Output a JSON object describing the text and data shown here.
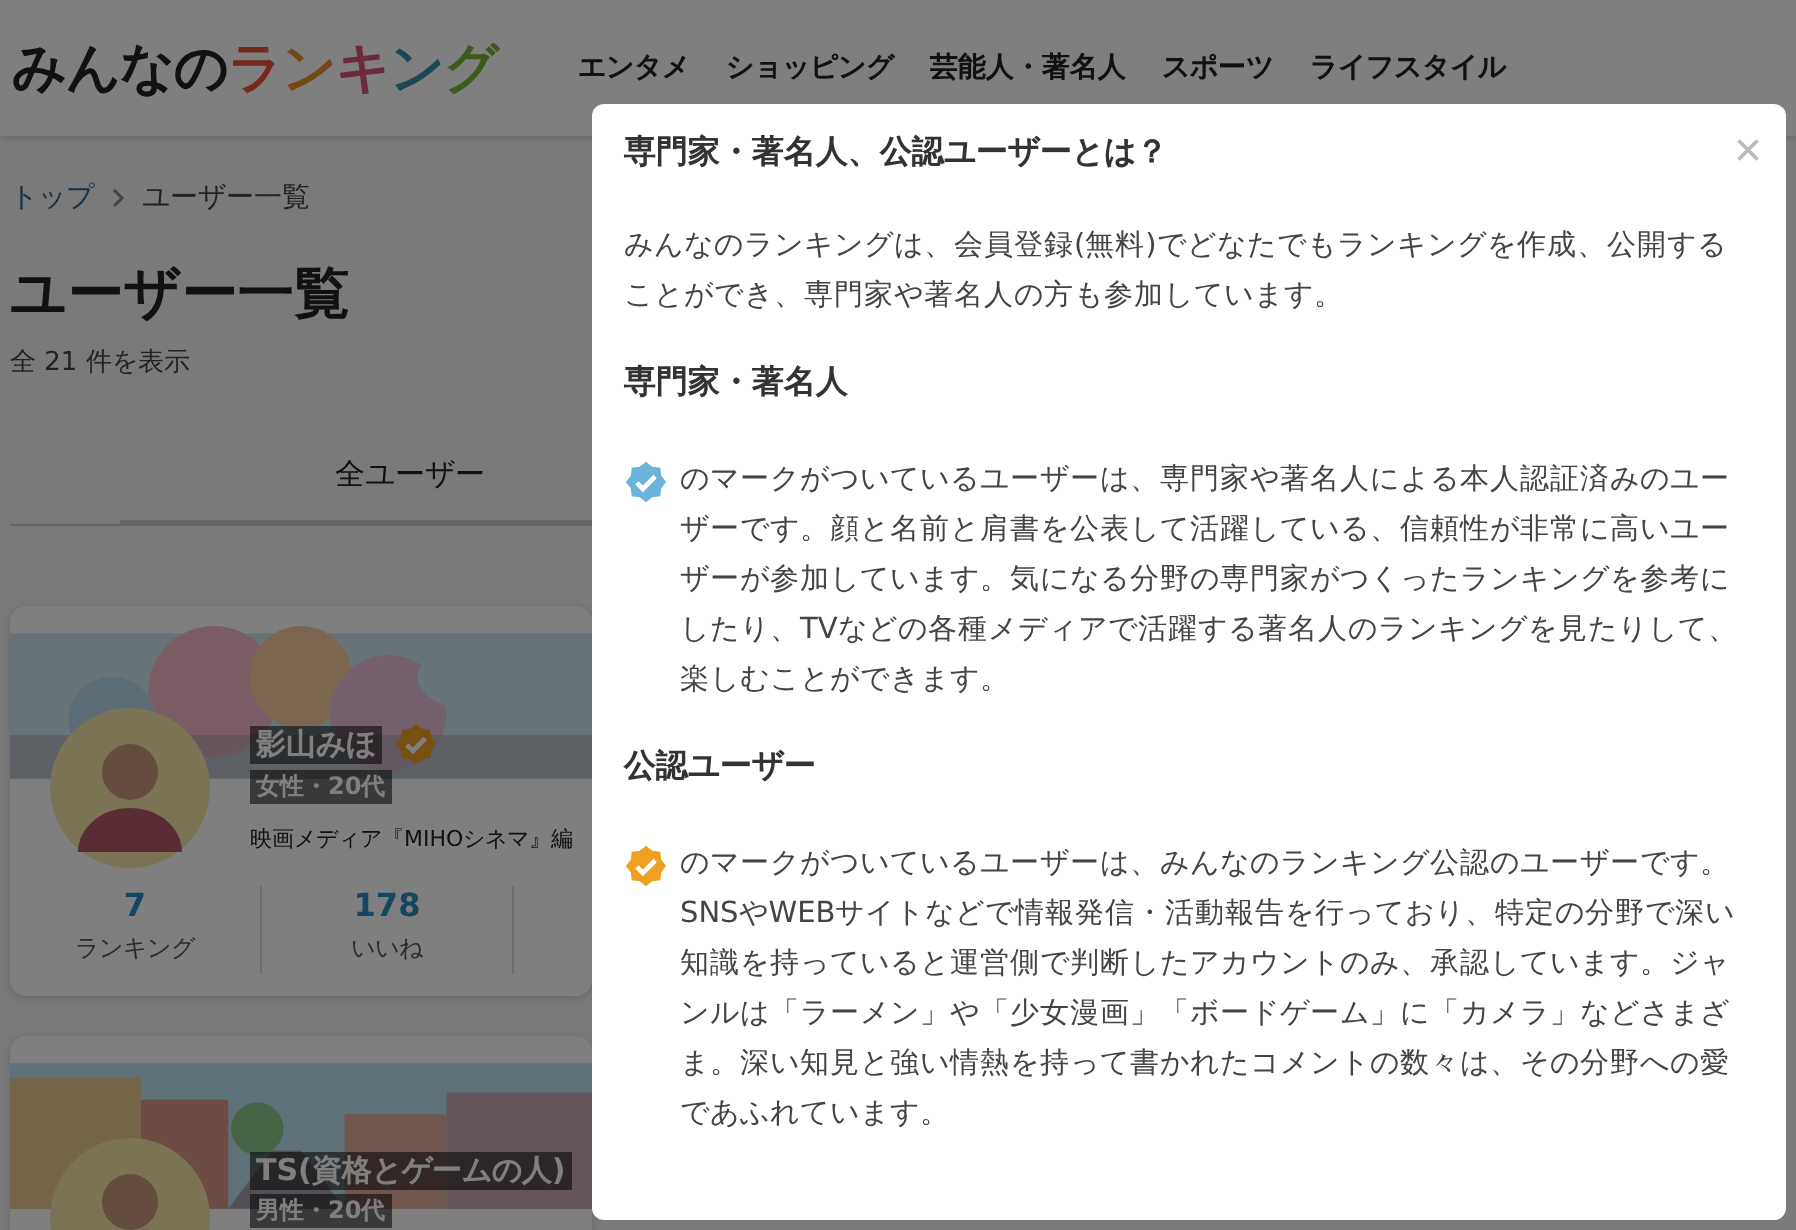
{
  "header": {
    "logo": "みんなのランキング",
    "nav": [
      "エンタメ",
      "ショッピング",
      "芸能人・著名人",
      "スポーツ",
      "ライフスタイル"
    ]
  },
  "breadcrumb": [
    "トップ",
    "ユーザー一覧"
  ],
  "page_title": "ユーザー一覧",
  "result_count": "全 21 件を表示",
  "tabs": [
    {
      "label": "全ユーザー",
      "selected": true
    }
  ],
  "users": [
    {
      "name": "影山みほ",
      "official": true,
      "meta": "女性・20代",
      "description": "映画メディア『MIHOシネマ』編",
      "stats": [
        {
          "value": "7",
          "label": "ランキング"
        },
        {
          "value": "178",
          "label": "いいね"
        }
      ]
    },
    {
      "name": "TS(資格とゲームの人)",
      "meta": "男性・20代"
    }
  ],
  "modal": {
    "title": "専門家・著名人、公認ユーザーとは？",
    "close": "×",
    "sections": [
      {
        "kind": "text",
        "text": "みんなのランキングは、会員登録(無料)でどなたでもランキングを作成、公開することができ、専門家や著名人の方も参加しています。"
      },
      {
        "kind": "heading",
        "text": "専門家・著名人"
      },
      {
        "kind": "expert_badge_text",
        "text": "のマークがついているユーザーは、専門家や著名人による本人認証済みのユーザーです。顔と名前と肩書を公表して活躍している、信頼性が非常に高いユーザーが参加しています。気になる分野の専門家がつくったランキングを参考にしたり、TVなどの各種メディアで活躍する著名人のランキングを見たりして、楽しむことができます。"
      },
      {
        "kind": "heading",
        "text": "公認ユーザー"
      },
      {
        "kind": "official_badge_text",
        "text": "のマークがついているユーザーは、みんなのランキング公認のユーザーです。SNSやWEBサイトなどで情報発信・活動報告を行っており、特定の分野で深い知識を持っていると運営側で判断したアカウントのみ、承認しています。ジャンルは「ラーメン」や「少女漫画」「ボードゲーム」に「カメラ」などさまざま。深い知見と強い情熱を持って書かれたコメントの数々は、その分野への愛であふれています。"
      }
    ]
  }
}
